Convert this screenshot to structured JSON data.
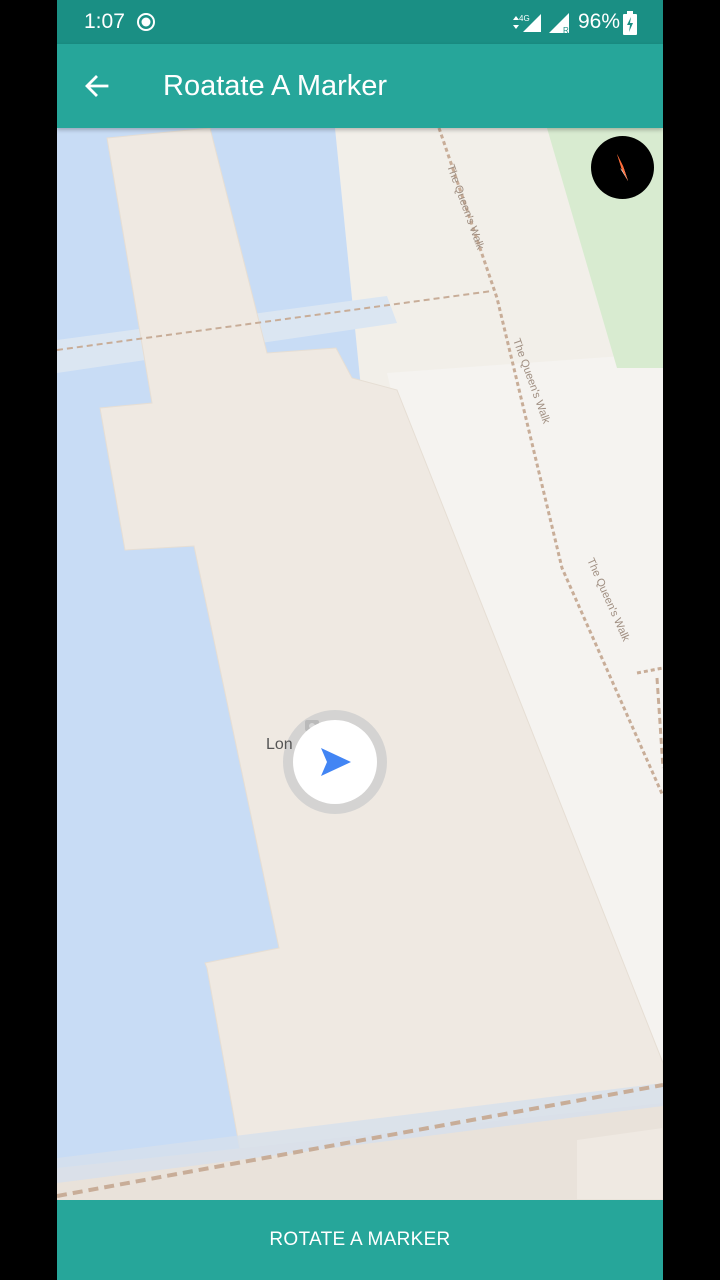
{
  "status_bar": {
    "time": "1:07",
    "network_label": "4G",
    "battery_percent": "96%"
  },
  "app_bar": {
    "title": "Roatate A Marker",
    "back_icon": "arrow-back-icon"
  },
  "map": {
    "compass_icon": "compass-icon",
    "street_labels": [
      "The Queen's Walk",
      "The Queen's Walk",
      "The Queen's Walk"
    ],
    "place_label": "Lon",
    "marker_icon": "navigation-arrow-icon",
    "colors": {
      "water": "#c8dcf5",
      "land": "#f2efe9",
      "pier": "#efe9e2",
      "park": "#d8ebd0",
      "path": "#c8ad98",
      "marker_arrow": "#4285f4"
    }
  },
  "footer": {
    "button_label": "ROTATE A MARKER"
  },
  "colors": {
    "primary": "#26a69a",
    "primary_dark": "#1a8f84"
  }
}
